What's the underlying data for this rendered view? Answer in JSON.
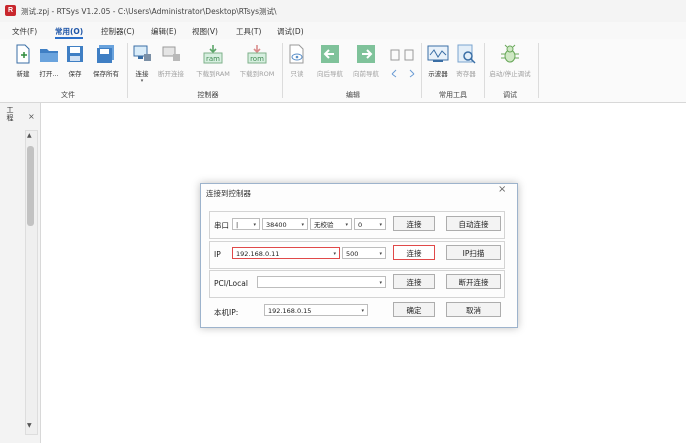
{
  "window": {
    "title": "测试.zpj - RTSys V1.2.05 - C:\\Users\\Administrator\\Desktop\\RTsys测试\\",
    "app_icon_letter": "R"
  },
  "menu": [
    "文件(F)",
    "常用(O)",
    "控制器(C)",
    "编辑(E)",
    "视图(V)",
    "工具(T)",
    "调试(D)"
  ],
  "ribbon": {
    "file_group": {
      "label": "文件",
      "buttons": [
        "新建",
        "打开...",
        "保存",
        "保存所有"
      ]
    },
    "controller_group": {
      "label": "控制器",
      "buttons": [
        "连接",
        "断开连接",
        "下载到RAM",
        "下载到ROM"
      ],
      "icon_text_ram": "ram",
      "icon_text_rom": "rom"
    },
    "edit_group": {
      "label": "编辑",
      "buttons": [
        "只读",
        "向后导航",
        "向前导航"
      ]
    },
    "tools_group": {
      "label": "常用工具",
      "buttons": [
        "示波器",
        "寄存器"
      ]
    },
    "debug_group": {
      "label": "调试",
      "buttons": [
        "启动/停止调试"
      ]
    }
  },
  "sidebar": {
    "tab_label": "工程",
    "close": "×",
    "scroll_up": "▲",
    "scroll_down": "▼"
  },
  "dialog": {
    "title": "连接到控制器",
    "close": "×",
    "serial": {
      "label": "串口",
      "port": "|",
      "baud": "38400",
      "parity": "无校验",
      "station": "0",
      "connect": "连接",
      "auto_connect": "自动连接"
    },
    "ip": {
      "label": "IP",
      "address": "192.168.0.11",
      "timeout": "500",
      "connect": "连接",
      "scan": "IP扫描"
    },
    "pci": {
      "label": "PCI/Local",
      "value": "",
      "connect": "连接",
      "disconnect": "断开连接"
    },
    "local_ip": {
      "label": "本机IP:",
      "value": "192.168.0.15",
      "ok": "确定",
      "cancel": "取消"
    }
  },
  "colors": {
    "accent": "#2b6fc9",
    "error": "#e04949",
    "app_red": "#c8262c"
  }
}
